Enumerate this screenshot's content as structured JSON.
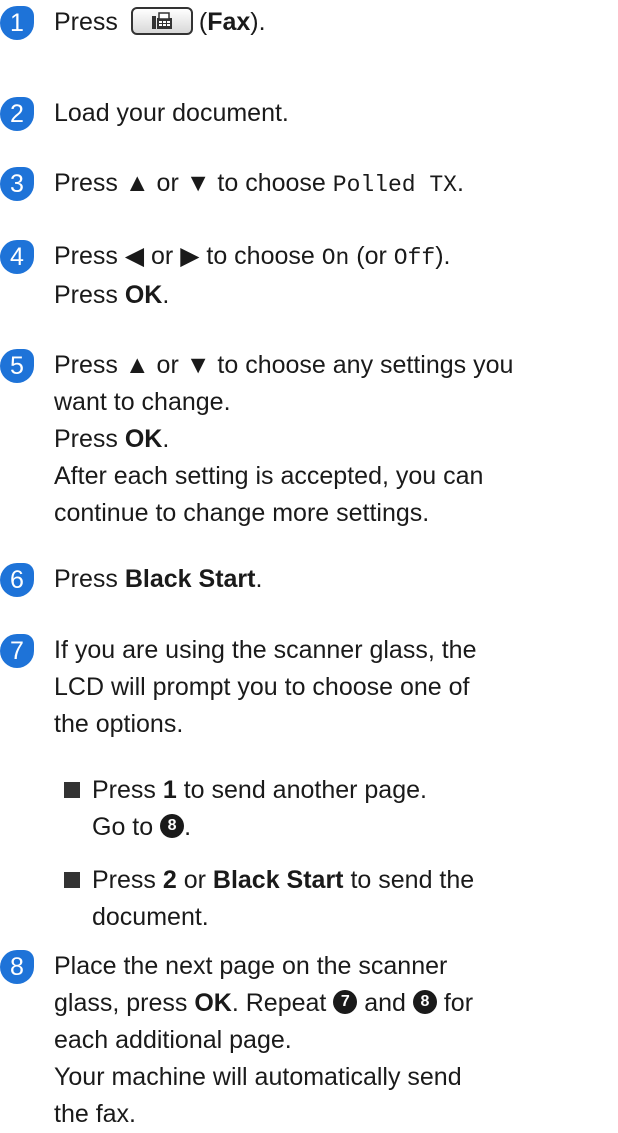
{
  "steps": [
    {
      "num": "1",
      "press": "Press",
      "fax_open": "(",
      "fax_bold": "Fax",
      "fax_close": ")."
    },
    {
      "num": "2",
      "text": "Load your document."
    },
    {
      "num": "3",
      "press": "Press ▲ or ▼ to choose ",
      "mono": "Polled TX",
      "end": "."
    },
    {
      "num": "4",
      "line1a": "Press ◀ or ▶ to choose ",
      "mono_on": "On",
      "mid": " (or ",
      "mono_off": "Off",
      "end": ").",
      "press2": "Press ",
      "ok": "OK",
      "dot": "."
    },
    {
      "num": "5",
      "line1": "Press ▲ or ▼ to choose any settings you",
      "line2": "want to change.",
      "press2": "Press ",
      "ok": "OK",
      "dot": ".",
      "line4": "After each setting is accepted, you can",
      "line5": "continue to change more settings."
    },
    {
      "num": "6",
      "press": "Press ",
      "bold": "Black Start",
      "dot": "."
    },
    {
      "num": "7",
      "line1": "If you are using the scanner glass, the",
      "line2": "LCD will prompt you to choose one of",
      "line3": "the options."
    },
    {
      "num": "8",
      "line1": "Place the next page on the scanner",
      "line2a": "glass, press ",
      "ok": "OK",
      "line2b": ". Repeat ",
      "ref7": "7",
      "and": " and ",
      "ref8": "8",
      "line2c": " for",
      "line3": "each additional page.",
      "line4": "Your machine will automatically send",
      "line5": "the fax."
    }
  ],
  "sub_items": [
    {
      "press": "Press ",
      "key": "1",
      "rest": " to send another page.",
      "goto": "Go to ",
      "ref": "8",
      "dot": "."
    },
    {
      "press": "Press ",
      "key": "2",
      "or": " or ",
      "bold": "Black Start",
      "rest": " to send the",
      "line2": "document."
    }
  ]
}
